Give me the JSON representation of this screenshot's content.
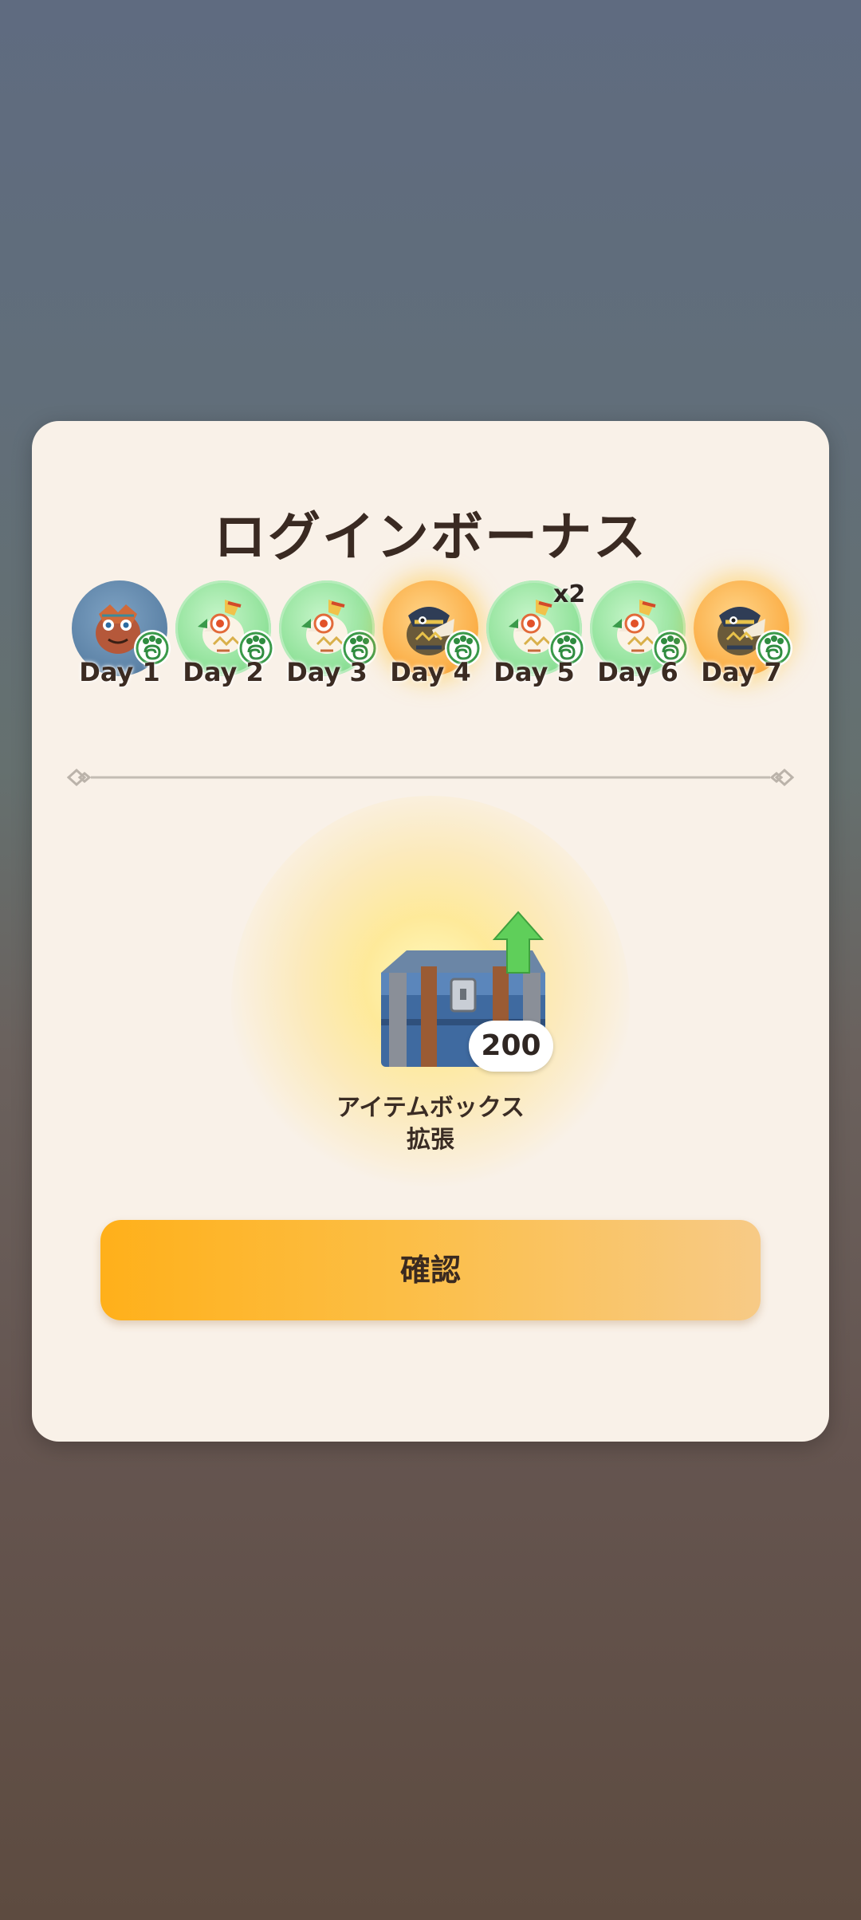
{
  "dialog": {
    "title": "ログインボーナス",
    "days": [
      {
        "label": "Day 1",
        "style": "blue",
        "creature": "red-monster-icon",
        "badge": "paw-spiral-badge-icon",
        "claimed": true
      },
      {
        "label": "Day 2",
        "style": "green",
        "creature": "white-bird-monster-icon",
        "badge": "paw-spiral-badge-icon"
      },
      {
        "label": "Day 3",
        "style": "green",
        "creature": "white-bird-monster-icon",
        "badge": "paw-spiral-badge-icon"
      },
      {
        "label": "Day 4",
        "style": "gold",
        "creature": "gold-monster-icon",
        "badge": "paw-spiral-badge-icon"
      },
      {
        "label": "Day 5",
        "style": "green",
        "creature": "white-bird-monster-icon",
        "badge": "paw-spiral-badge-icon",
        "multiplier": "x2"
      },
      {
        "label": "Day 6",
        "style": "green",
        "creature": "white-bird-monster-icon",
        "badge": "paw-spiral-badge-icon"
      },
      {
        "label": "Day 7",
        "style": "gold",
        "creature": "gold-monster-icon",
        "badge": "paw-spiral-badge-icon",
        "current": true
      }
    ],
    "reward": {
      "icon": "item-box-chest-upgrade-icon",
      "count": "200",
      "name_line1": "アイテムボックス",
      "name_line2": "拡張"
    },
    "confirm_label": "確認"
  },
  "colors": {
    "panel_bg": "#f9f1e8",
    "title_text": "#3a2a22",
    "button_start": "#ffb01a",
    "button_end": "#f7ca86",
    "medal_green": "#94e39d",
    "medal_gold": "#fbb04a",
    "medal_blue": "#5c82a6"
  }
}
